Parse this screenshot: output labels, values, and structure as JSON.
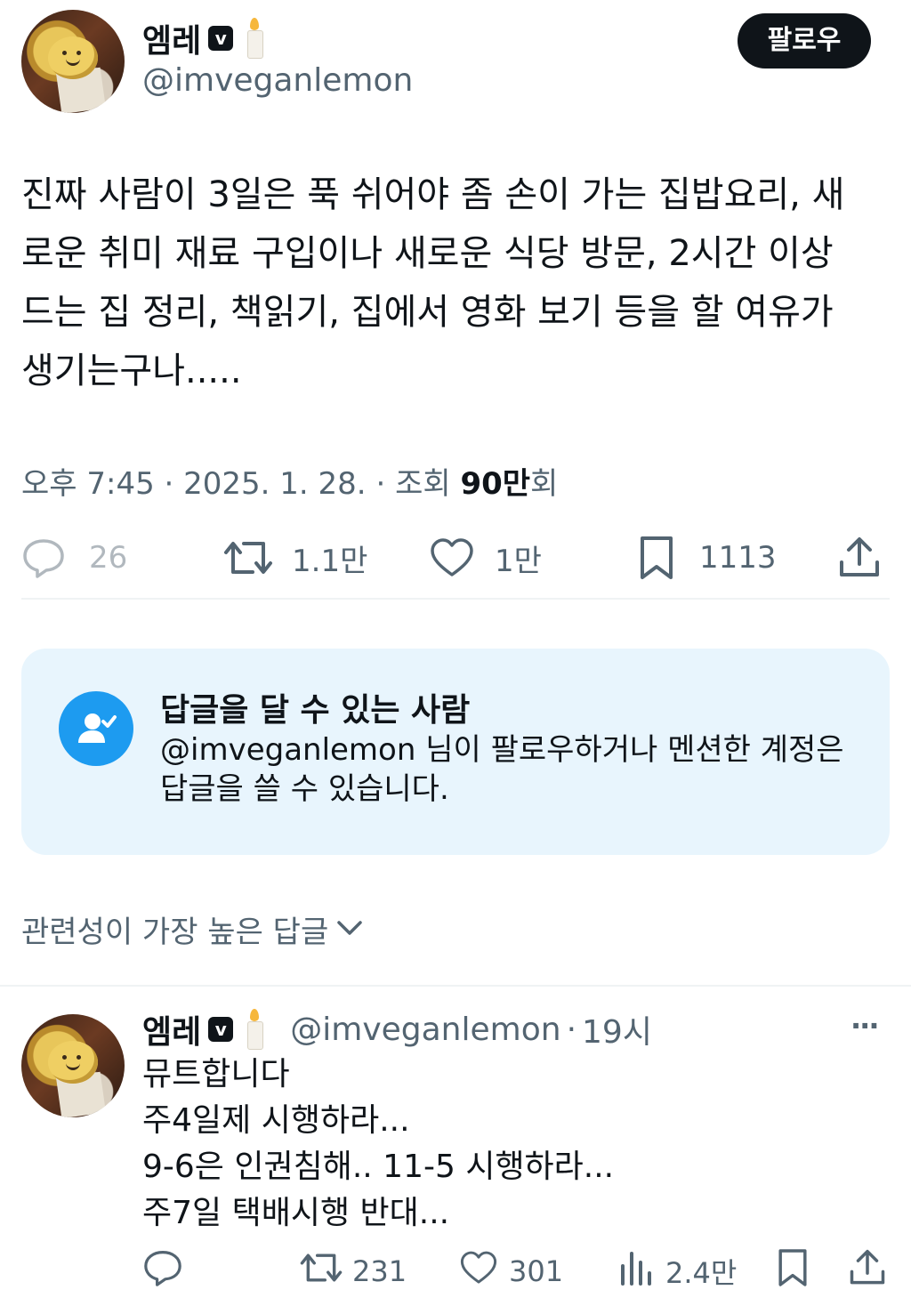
{
  "author": {
    "name": "엠레",
    "verified_badge": "v",
    "badge_icon": "candle-icon",
    "handle": "@imveganlemon"
  },
  "follow_button": {
    "label": "팔로우"
  },
  "tweet": {
    "lines": [
      "진짜 사람이 3일은 푹 쉬어야 좀 손이 가는 집밥요리, 새",
      "로운 취미 재료 구입이나 새로운 식당 방문, 2시간 이상",
      "드는 집 정리, 책읽기, 집에서 영화 보기 등을 할 여유가",
      "생기는구나....."
    ],
    "time": "오후 7:45",
    "date": "2025. 1. 28.",
    "views_prefix": "조회",
    "views_value": "90만",
    "views_suffix": "회",
    "separator": "·"
  },
  "actions": {
    "reply_count": "26",
    "retweet_count": "1.1만",
    "like_count": "1만",
    "bookmark_count": "1113"
  },
  "reply_restriction": {
    "title": "답글을 달 수 있는 사람",
    "line1": "@imveganlemon 님이 팔로우하거나 멘션한 계정은",
    "line2": "답글을 쓸 수 있습니다."
  },
  "sort": {
    "label": "관련성이 가장 높은 답글"
  },
  "reply": {
    "name": "엠레",
    "verified_badge": "v",
    "handle": "@imveganlemon",
    "separator": "·",
    "time": "19시",
    "more_label": "···",
    "lines": [
      "뮤트합니다",
      "주4일제 시행하라...",
      "9-6은 인권침해.. 11-5 시행하라...",
      "주7일 택배시행 반대..."
    ],
    "retweet_count": "231",
    "like_count": "301",
    "views_count": "2.4만"
  },
  "colors": {
    "text": "#0f1419",
    "secondary": "#536471",
    "accent": "#1d9bf0",
    "info_bg": "#e8f5fd",
    "divider": "#eff3f4"
  }
}
